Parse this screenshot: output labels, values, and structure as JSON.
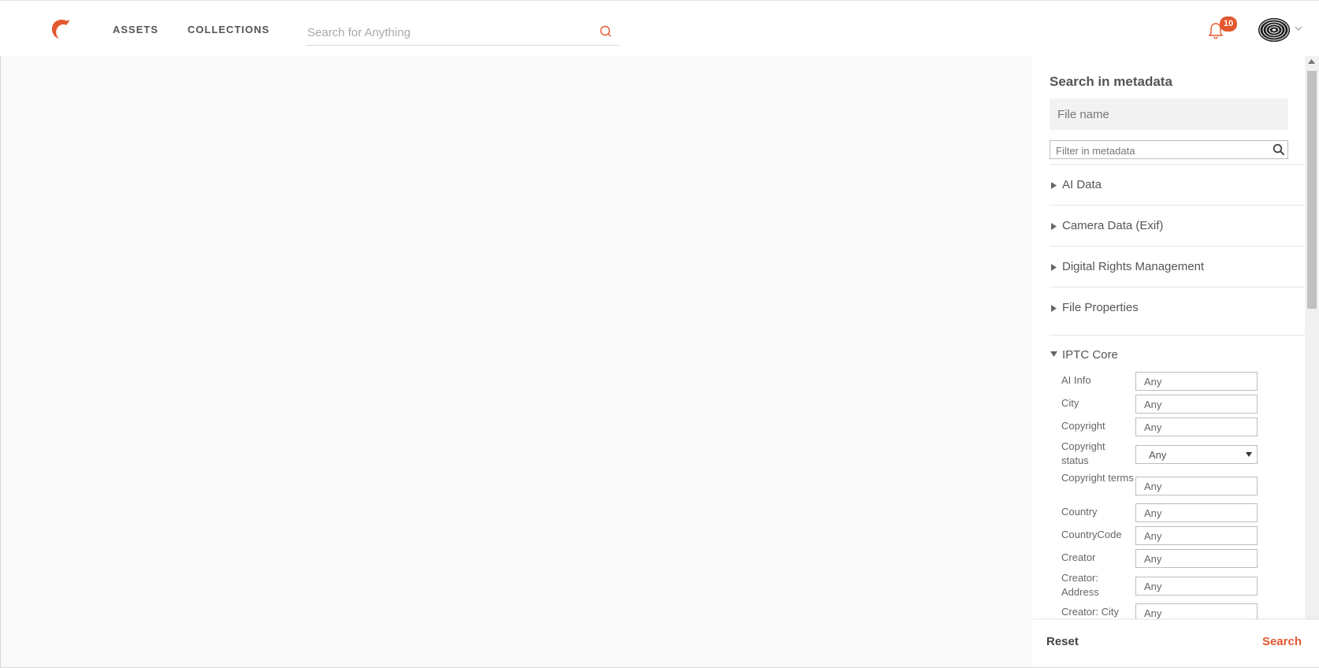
{
  "nav": {
    "assets": "ASSETS",
    "collections": "COLLECTIONS",
    "search_placeholder": "Search for Anything",
    "notification_count": "10"
  },
  "panel": {
    "title": "Search in metadata",
    "filename_placeholder": "File name",
    "filter_placeholder": "Filter in metadata",
    "sections": [
      {
        "label": "AI Data",
        "expanded": false
      },
      {
        "label": "Camera Data (Exif)",
        "expanded": false
      },
      {
        "label": "Digital Rights Management",
        "expanded": false
      },
      {
        "label": "File Properties",
        "expanded": false
      },
      {
        "label": "IPTC Core",
        "expanded": true
      }
    ],
    "iptc_fields": [
      {
        "label": "AI Info",
        "value": "Any",
        "type": "input"
      },
      {
        "label": "City",
        "value": "Any",
        "type": "input"
      },
      {
        "label": "Copyright",
        "value": "Any",
        "type": "input"
      },
      {
        "label": "Copyright status",
        "value": "Any",
        "type": "select"
      },
      {
        "label": "Copyright terms",
        "value": "Any",
        "type": "input"
      },
      {
        "label": "Country",
        "value": "Any",
        "type": "input"
      },
      {
        "label": "CountryCode",
        "value": "Any",
        "type": "input"
      },
      {
        "label": "Creator",
        "value": "Any",
        "type": "input"
      },
      {
        "label": "Creator: Address",
        "value": "Any",
        "type": "input"
      },
      {
        "label": "Creator: City",
        "value": "Any",
        "type": "input"
      }
    ],
    "reset_label": "Reset",
    "search_label": "Search"
  },
  "colors": {
    "accent": "#e4572e",
    "text": "#555555",
    "background": "#f9f9f9"
  },
  "icons": [
    "logo-icon",
    "search-icon",
    "bell-icon",
    "avatar",
    "chevron-down-icon",
    "triangle-right-icon",
    "triangle-down-icon"
  ]
}
